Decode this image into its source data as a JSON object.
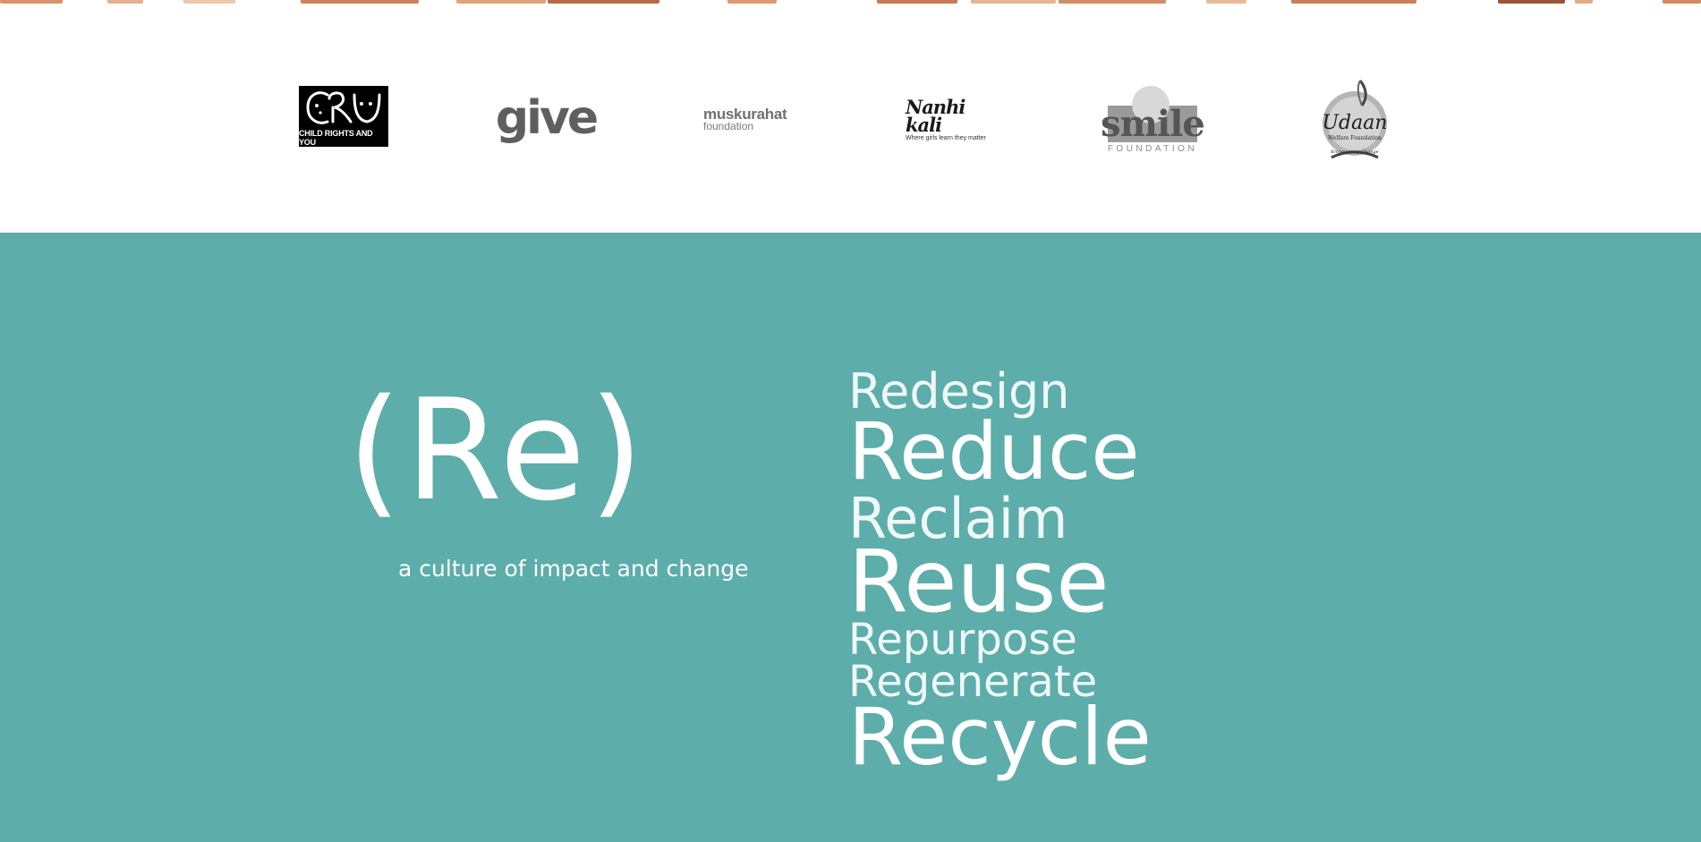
{
  "partner_logos": {
    "cry": {
      "mark": "CRY",
      "subtitle": "CHILD RIGHTS AND YOU"
    },
    "give": {
      "text": "give"
    },
    "muskurahat": {
      "name": "muskurahat",
      "sub": "foundation"
    },
    "nanhi_kali": {
      "name": "Nanhi kali",
      "tagline": "Where girls learn they matter"
    },
    "smile": {
      "word": "smile",
      "sub": "FOUNDATION"
    },
    "udaan": {
      "name": "Udaan",
      "sub": "Welfare Foundation",
      "tagline": "Empowering Change"
    }
  },
  "hero": {
    "title": "(Re)",
    "tagline": "a culture of impact and change"
  },
  "re_words": [
    "Redesign",
    "Reduce",
    "Reclaim",
    "Reuse",
    "Repurpose",
    "Regenerate",
    "Recycle"
  ],
  "colors": {
    "teal_background": "#5dadaa",
    "text_white": "#ffffff",
    "logo_gray": "#5f5f5f"
  }
}
